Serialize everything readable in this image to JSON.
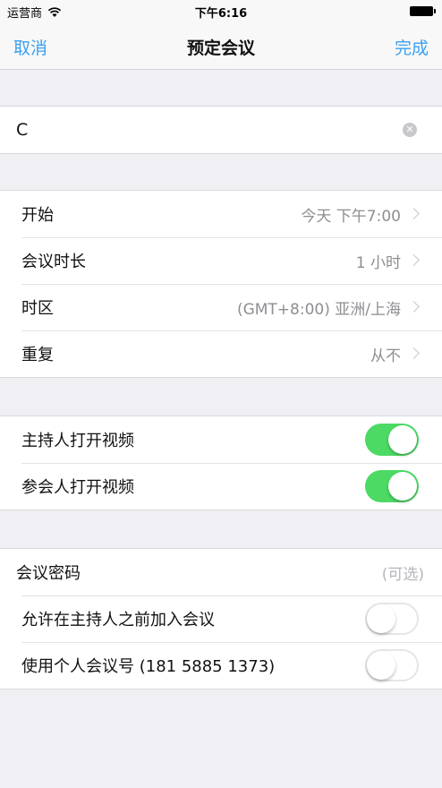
{
  "status_bar": {
    "carrier": "运营商",
    "time": "下午6:16"
  },
  "nav": {
    "cancel": "取消",
    "title": "预定会议",
    "done": "完成"
  },
  "meeting_name": {
    "value": "C"
  },
  "schedule": [
    {
      "label": "开始",
      "value": "今天 下午7:00"
    },
    {
      "label": "会议时长",
      "value": "1 小时"
    },
    {
      "label": "时区",
      "value": "(GMT+8:00) 亚洲/上海"
    },
    {
      "label": "重复",
      "value": "从不"
    }
  ],
  "video": [
    {
      "label": "主持人打开视频",
      "on": true
    },
    {
      "label": "参会人打开视频",
      "on": true
    }
  ],
  "options": {
    "password_label": "会议密码",
    "password_placeholder": "(可选)",
    "join_before_host": {
      "label": "允许在主持人之前加入会议",
      "on": false
    },
    "personal_meeting_id": {
      "label": "使用个人会议号 (181 5885 1373)",
      "on": false
    }
  },
  "colors": {
    "accent": "#3aa0ef",
    "toggle_on": "#4cd964",
    "background": "#efeff4"
  }
}
